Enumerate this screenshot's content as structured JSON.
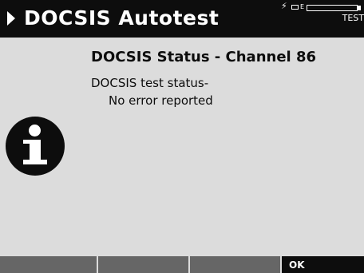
{
  "header": {
    "title": "DOCSIS Autotest",
    "mode_indicator": "TEST",
    "mode_letter": "E",
    "icons": [
      "play-arrow-icon",
      "power-icon",
      "plug-icon",
      "battery-icon"
    ]
  },
  "dialog": {
    "heading": "DOCSIS Status - Channel 86",
    "message_line1": "DOCSIS test status-",
    "message_line2": "No error reported",
    "icon": "info-icon"
  },
  "softkeys": [
    {
      "label": ""
    },
    {
      "label": ""
    },
    {
      "label": ""
    },
    {
      "label": "OK"
    }
  ],
  "colors": {
    "header_bg": "#0d0d0d",
    "body_bg": "#dcdcdc",
    "softkey_bg": "#666666",
    "text": "#0d0d0d"
  }
}
